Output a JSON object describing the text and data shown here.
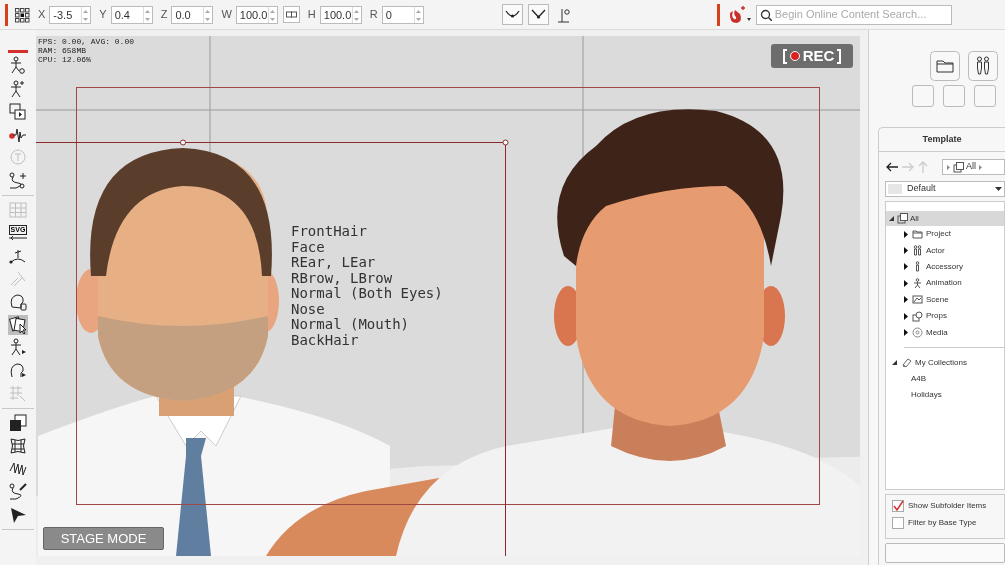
{
  "transform_fields": [
    {
      "kind": "field",
      "label": "X",
      "value": "-3.5"
    },
    {
      "kind": "field",
      "label": "Y",
      "value": "0.4"
    },
    {
      "kind": "field",
      "label": "Z",
      "value": "0.0"
    },
    {
      "kind": "field",
      "label": "W",
      "value": "100.0"
    },
    {
      "kind": "link"
    },
    {
      "kind": "field",
      "label": "H",
      "value": "100.0"
    },
    {
      "kind": "field",
      "label": "R",
      "value": "0"
    }
  ],
  "search": {
    "placeholder": "Begin Online Content Search..."
  },
  "tool_groups": [
    [
      {
        "selected": false,
        "disabled": false
      },
      {
        "selected": false,
        "disabled": false
      },
      {
        "selected": false,
        "disabled": false
      },
      {
        "selected": false,
        "disabled": false
      },
      {
        "selected": false,
        "disabled": true
      },
      {
        "selected": false,
        "disabled": false
      }
    ],
    [
      {
        "selected": false,
        "disabled": true
      },
      {
        "selected": false,
        "disabled": false,
        "label": "SVG"
      },
      {
        "selected": false,
        "disabled": false
      },
      {
        "selected": false,
        "disabled": true
      },
      {
        "selected": false,
        "disabled": false
      },
      {
        "selected": true,
        "disabled": false
      },
      {
        "selected": false,
        "disabled": false
      },
      {
        "selected": false,
        "disabled": false
      },
      {
        "selected": false,
        "disabled": true
      }
    ],
    [
      {
        "selected": false,
        "disabled": false
      },
      {
        "selected": false,
        "disabled": false
      },
      {
        "selected": false,
        "disabled": false
      },
      {
        "selected": false,
        "disabled": false
      },
      {
        "selected": false,
        "disabled": false
      }
    ]
  ],
  "stage": {
    "stats": [
      "FPS: 0.00, AVG: 0.00",
      "RAM: 658MB",
      "CPU: 12.06%"
    ],
    "layers": [
      "FrontHair",
      "Face",
      "REar, LEar",
      "RBrow, LBrow",
      "Normal (Both Eyes)",
      "Nose",
      "Normal (Mouth)",
      "BackHair"
    ],
    "rec_label": "REC",
    "mode_button": "STAGE MODE"
  },
  "content_panel": {
    "tab": "Template",
    "breadcrumb": "All",
    "filter": "Default",
    "tree": [
      {
        "label": "All",
        "selected": true,
        "expanded": true,
        "children": [
          {
            "label": "Project",
            "expanded": false
          },
          {
            "label": "Actor",
            "expanded": false
          },
          {
            "label": "Accessory",
            "expanded": false
          },
          {
            "label": "Animation",
            "expanded": false
          },
          {
            "label": "Scene",
            "expanded": false
          },
          {
            "label": "Props",
            "expanded": false
          },
          {
            "label": "Media",
            "expanded": false
          }
        ]
      }
    ],
    "collections": {
      "label": "My Collections",
      "expanded": true,
      "children": [
        "A4B",
        "Holidays"
      ]
    },
    "options": [
      {
        "label": "Show Subfolder Items",
        "checked": true
      },
      {
        "label": "Filter by Base Type",
        "checked": false
      }
    ]
  }
}
